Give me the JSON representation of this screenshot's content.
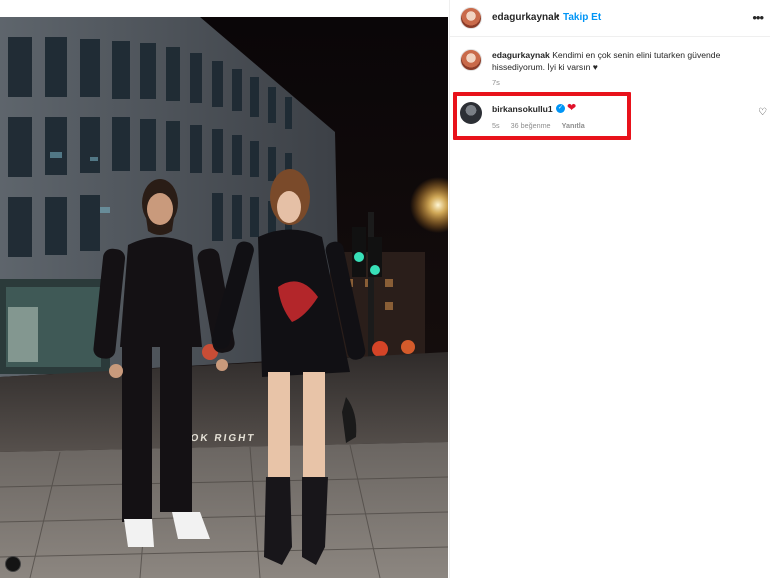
{
  "post": {
    "author": "edagurkaynak",
    "follow_label": "Takip Et",
    "separator": "•",
    "more_icon": "more-horizontal-icon",
    "caption_user": "edagurkaynak",
    "caption_text": "Kendimi en çok senin elini tutarken güvende hissediyorum. İyi ki varsın ♥",
    "caption_time": "7s"
  },
  "comment": {
    "user": "birkansokullu1",
    "verified_icon": "verified-badge-icon",
    "text": "❤",
    "time": "5s",
    "likes": "36 beğenme",
    "reply_label": "Yanıtla",
    "like_icon": "heart-outline-icon"
  },
  "photo": {
    "street_marking": "LOOK RIGHT"
  },
  "colors": {
    "link_blue": "#0095f6",
    "highlight_red": "#e8121b",
    "muted_gray": "#8e8e8e"
  }
}
